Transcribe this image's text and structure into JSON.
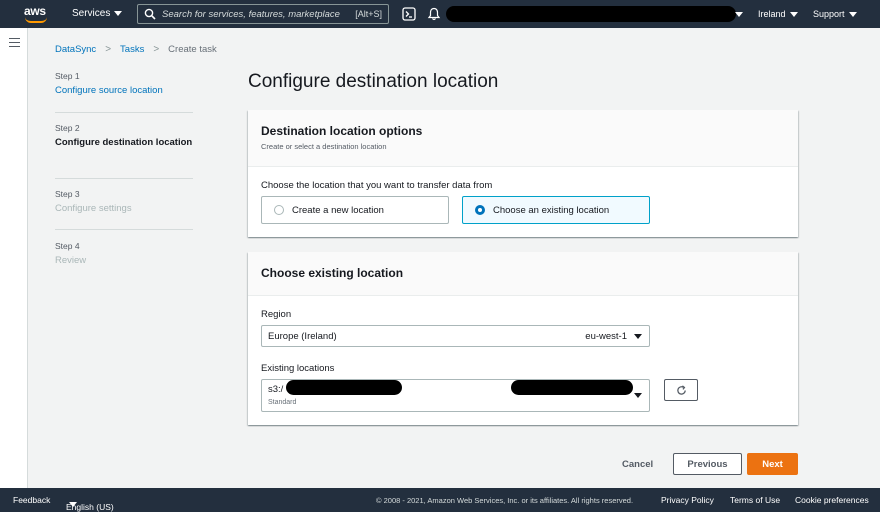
{
  "topnav": {
    "logo_text": "aws",
    "services_label": "Services",
    "search_placeholder": "Search for services, features, marketplace p",
    "search_shortcut": "[Alt+S]",
    "region_label": "Ireland",
    "support_label": "Support"
  },
  "breadcrumb": {
    "items": [
      "DataSync",
      "Tasks",
      "Create task"
    ]
  },
  "steps": [
    {
      "num": "Step 1",
      "label": "Configure source location"
    },
    {
      "num": "Step 2",
      "label": "Configure destination location"
    },
    {
      "num": "Step 3",
      "label": "Configure settings"
    },
    {
      "num": "Step 4",
      "label": "Review"
    }
  ],
  "page_title": "Configure destination location",
  "options_panel": {
    "title": "Destination location options",
    "description": "Create or select a destination location",
    "prompt": "Choose the location that you want to transfer data from",
    "choices": [
      "Create a new location",
      "Choose an existing location"
    ],
    "selected": "Choose an existing location"
  },
  "existing_panel": {
    "title": "Choose existing location",
    "region_label": "Region",
    "region_value": "Europe (Ireland)",
    "region_code": "eu-west-1",
    "locations_label": "Existing locations",
    "location_value": "s3:/",
    "location_storage_class": "Standard"
  },
  "actions": {
    "cancel": "Cancel",
    "previous": "Previous",
    "next": "Next"
  },
  "footer": {
    "feedback": "Feedback",
    "language": "English (US)",
    "copyright": "© 2008 - 2021, Amazon Web Services, Inc. or its affiliates. All rights reserved.",
    "privacy": "Privacy Policy",
    "terms": "Terms of Use",
    "cookies": "Cookie preferences"
  },
  "colors": {
    "nav_bg": "#232f3e",
    "accent_orange": "#ec7211",
    "link_blue": "#0073bb",
    "selected_tile_border": "#00a1c9"
  }
}
